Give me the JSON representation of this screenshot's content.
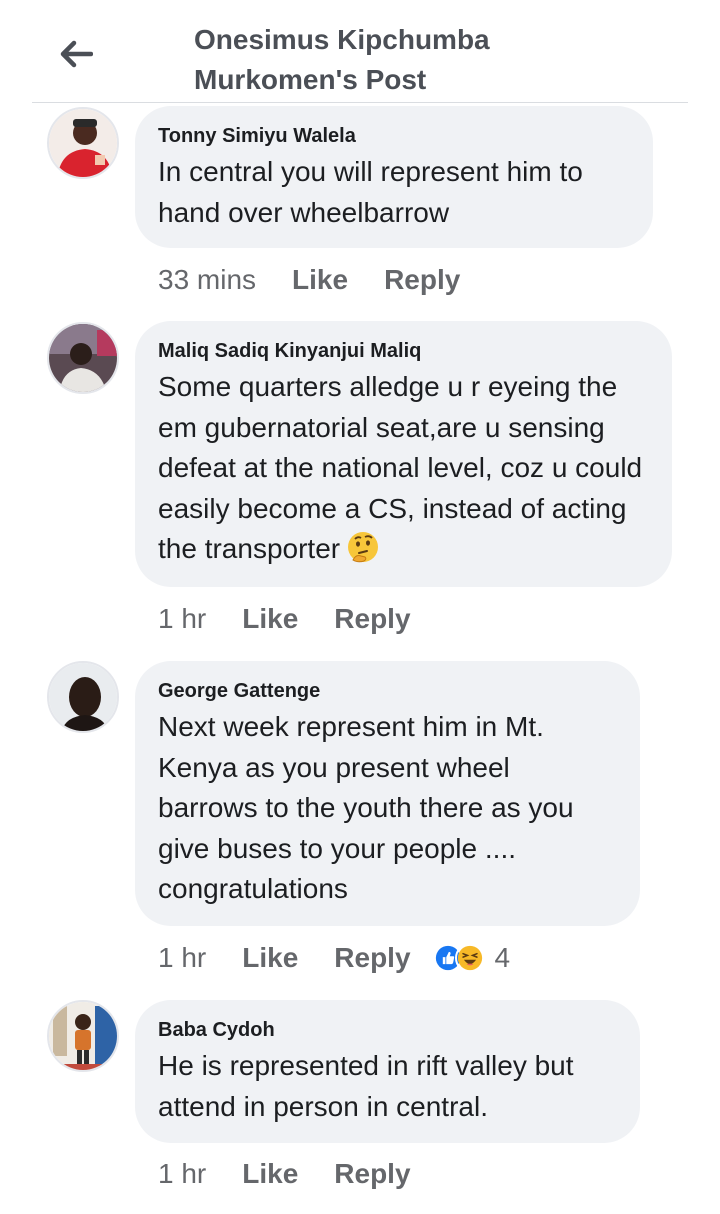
{
  "header": {
    "title": "Onesimus Kipchumba Murkomen's Post"
  },
  "icons": {
    "back": "arrow-left-icon",
    "like_reaction": "like-reaction-icon",
    "haha_reaction": "haha-reaction-icon",
    "thinking_emoji": "thinking-face-emoji"
  },
  "colors": {
    "bubble": "#f0f2f5",
    "meta_text": "#65676b",
    "like_blue": "#1877f2",
    "haha_yellow": "#f7b928"
  },
  "comments": [
    {
      "author": "Tonny Simiyu Walela",
      "text": "In central you will represent him to hand over wheelbarrow",
      "time": "33 mins",
      "like": "Like",
      "reply": "Reply"
    },
    {
      "author": "Maliq Sadiq Kinyanjui Maliq",
      "text": "Some quarters alledge u r eyeing the em gubernatorial seat,are u sensing defeat at the national level, coz u could easily become a CS, instead of acting the transporter",
      "time": "1 hr",
      "like": "Like",
      "reply": "Reply"
    },
    {
      "author": "George Gattenge",
      "text": "Next week represent him in Mt. Kenya as you present wheel barrows to the youth there as you give buses to your people .... congratulations",
      "time": "1 hr",
      "like": "Like",
      "reply": "Reply",
      "reaction_count": "4"
    },
    {
      "author": "Baba Cydoh",
      "text": "He is represented in rift valley but attend in person in central.",
      "time": "1 hr",
      "like": "Like",
      "reply": "Reply"
    }
  ]
}
